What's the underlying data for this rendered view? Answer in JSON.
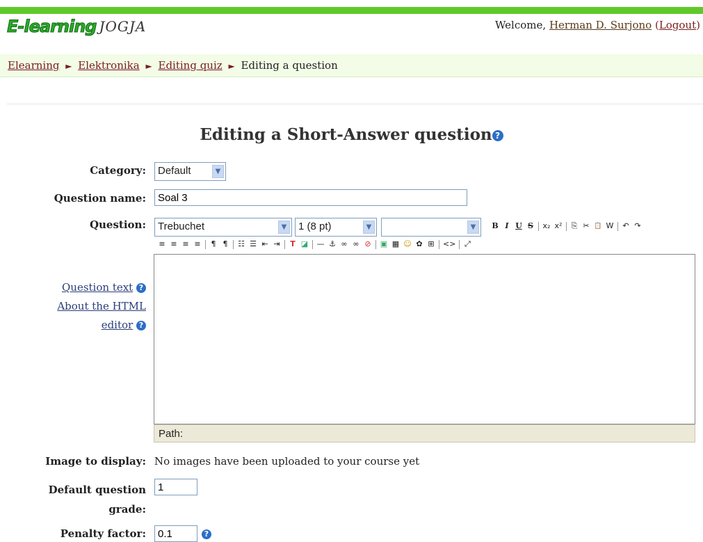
{
  "header": {
    "logo_main": "E-learning",
    "logo_sub": "JOGJA",
    "welcome_prefix": "Welcome,",
    "user_name": "Herman D. Surjono",
    "logout_open": "(",
    "logout_label": "Logout",
    "logout_close": ")",
    "accent_color": "#5fc929"
  },
  "breadcrumb": {
    "items": [
      "Elearning",
      "Elektronika",
      "Editing quiz"
    ],
    "current": "Editing a question",
    "separator": "►"
  },
  "page": {
    "title": "Editing a Short-Answer question",
    "help_icon": "?"
  },
  "form": {
    "category_label": "Category:",
    "category_value": "Default",
    "question_name_label": "Question name:",
    "question_name_value": "Soal 3",
    "question_label": "Question:",
    "font_family_value": "Trebuchet",
    "font_size_value": "1 (8 pt)",
    "font_style_value": "",
    "path_label": "Path:",
    "question_text_link": "Question text",
    "about_html_line1": "About the HTML",
    "about_html_line2": "editor",
    "image_label": "Image to display:",
    "image_value": "No images have been uploaded to your course yet",
    "grade_label_line1": "Default question",
    "grade_label_line2": "grade:",
    "grade_value": "1",
    "penalty_label": "Penalty factor:",
    "penalty_value": "0.1"
  },
  "toolbar": {
    "bold": "B",
    "italic": "I",
    "underline": "U",
    "strike": "S",
    "subscript": "x₂",
    "superscript": "x²",
    "copy": "⎘",
    "cut": "✂",
    "paste": "📋",
    "clean": "W",
    "undo": "↶",
    "redo": "↷",
    "align_left": "≡",
    "align_center": "≡",
    "align_right": "≡",
    "justify": "≡",
    "ltr": "¶",
    "rtl": "¶",
    "ordered_list": "☷",
    "unordered_list": "☰",
    "outdent": "⇤",
    "indent": "⇥",
    "text_color": "T",
    "bg_color": "◪",
    "hr": "—",
    "anchor": "⚓",
    "link": "∞",
    "unlink": "∞",
    "nolink": "⊘",
    "image": "▣",
    "table": "▦",
    "smiley": "☺",
    "special_char": "✿",
    "search_replace": "⊞",
    "html_source": "<>",
    "fullscreen": "⤢"
  }
}
